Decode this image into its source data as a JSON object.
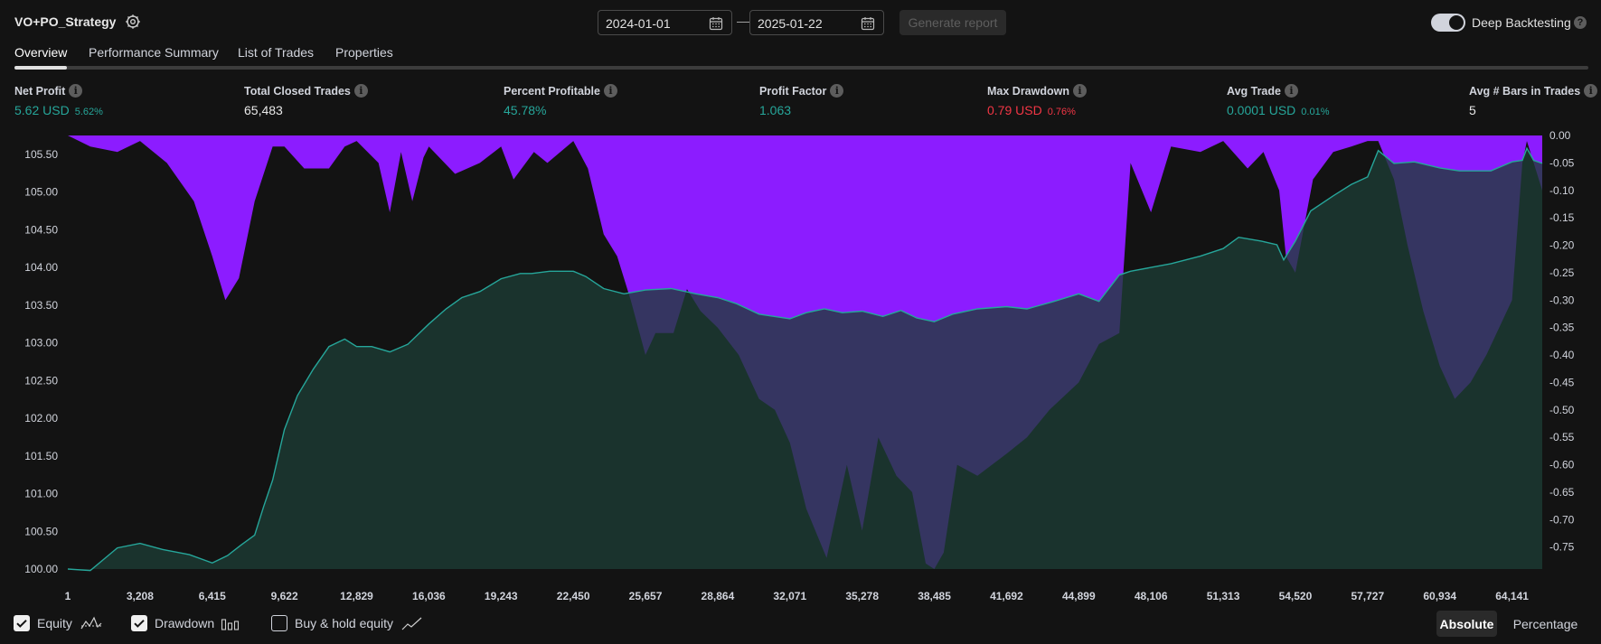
{
  "header": {
    "strategy_name": "VO+PO_Strategy",
    "start_date": "2024-01-01",
    "end_date": "2025-01-22",
    "date_separator": "—",
    "generate_label": "Generate report",
    "deep_backtesting_label": "Deep Backtesting",
    "deep_backtesting_on": true,
    "help_glyph": "?"
  },
  "tabs": [
    {
      "label": "Overview",
      "active": true
    },
    {
      "label": "Performance Summary",
      "active": false
    },
    {
      "label": "List of Trades",
      "active": false
    },
    {
      "label": "Properties",
      "active": false
    }
  ],
  "metrics": {
    "info_glyph": "i",
    "net_profit": {
      "label": "Net Profit",
      "value": "5.62 USD",
      "sub": "5.62%"
    },
    "total_closed_trades": {
      "label": "Total Closed Trades",
      "value": "65,483"
    },
    "percent_profitable": {
      "label": "Percent Profitable",
      "value": "45.78%"
    },
    "profit_factor": {
      "label": "Profit Factor",
      "value": "1.063"
    },
    "max_drawdown": {
      "label": "Max Drawdown",
      "value": "0.79 USD",
      "sub": "0.76%"
    },
    "avg_trade": {
      "label": "Avg Trade",
      "value": "0.0001 USD",
      "sub": "0.01%"
    },
    "avg_bars": {
      "label": "Avg # Bars in Trades",
      "value": "5"
    }
  },
  "legend": {
    "equity_label": "Equity",
    "equity_checked": true,
    "drawdown_label": "Drawdown",
    "drawdown_checked": true,
    "bh_label": "Buy & hold equity",
    "bh_checked": false
  },
  "modes": {
    "absolute_label": "Absolute",
    "percentage_label": "Percentage",
    "active": "Absolute"
  },
  "colors": {
    "background": "#131313",
    "equity_line": "#26a69a",
    "equity_fill": "#1c3c34",
    "drawdown_fill": "#8c1cff",
    "negative": "#f23645",
    "text": "#d1d4dc"
  },
  "chart_data": {
    "type": "area",
    "title": "",
    "xlabel": "",
    "ylabel": "",
    "x_ticks": [
      "1",
      "3,208",
      "6,415",
      "9,622",
      "12,829",
      "16,036",
      "19,243",
      "22,450",
      "25,657",
      "28,864",
      "32,071",
      "35,278",
      "38,485",
      "41,692",
      "44,899",
      "48,106",
      "51,313",
      "54,520",
      "57,727",
      "60,934",
      "64,141"
    ],
    "y_left_ticks": [
      "105.50",
      "105.00",
      "104.50",
      "104.00",
      "103.50",
      "103.00",
      "102.50",
      "102.00",
      "101.50",
      "101.00",
      "100.50",
      "100.00"
    ],
    "y_right_ticks": [
      "0.00",
      "-0.05",
      "-0.10",
      "-0.15",
      "-0.20",
      "-0.25",
      "-0.30",
      "-0.35",
      "-0.40",
      "-0.45",
      "-0.50",
      "-0.55",
      "-0.60",
      "-0.65",
      "-0.70",
      "-0.75"
    ],
    "xlim": [
      1,
      65483
    ],
    "ylim_left": [
      100.0,
      105.75
    ],
    "ylim_right": [
      -0.79,
      0.0
    ],
    "grid": false,
    "series": [
      {
        "name": "Equity",
        "x": [
          1,
          1000,
          2200,
          3208,
          4200,
          5400,
          6415,
          7100,
          7700,
          8300,
          8700,
          9100,
          9622,
          10200,
          10900,
          11600,
          12300,
          12829,
          13500,
          14300,
          15100,
          16036,
          16800,
          17500,
          18300,
          19243,
          20100,
          20600,
          21400,
          22450,
          23000,
          23800,
          24700,
          25657,
          26800,
          27900,
          28864,
          29700,
          30700,
          32071,
          32800,
          33600,
          34400,
          35278,
          36200,
          37000,
          37700,
          38485,
          39300,
          40400,
          41692,
          42600,
          43800,
          44899,
          45800,
          46700,
          47200,
          48106,
          49000,
          50300,
          51313,
          52000,
          53000,
          53700,
          54000,
          54520,
          55200,
          56200,
          57000,
          57727,
          58200,
          58900,
          59800,
          60934,
          61800,
          63200,
          64141,
          64600,
          64800,
          65100,
          65483
        ],
        "values": [
          100.0,
          99.98,
          100.28,
          100.34,
          100.26,
          100.19,
          100.08,
          100.18,
          100.32,
          100.45,
          100.83,
          101.18,
          101.85,
          102.3,
          102.65,
          102.95,
          103.05,
          102.95,
          102.95,
          102.88,
          102.98,
          103.25,
          103.45,
          103.6,
          103.68,
          103.85,
          103.92,
          103.92,
          103.95,
          103.95,
          103.88,
          103.72,
          103.65,
          103.7,
          103.72,
          103.65,
          103.6,
          103.52,
          103.38,
          103.32,
          103.4,
          103.45,
          103.4,
          103.42,
          103.35,
          103.43,
          103.33,
          103.28,
          103.38,
          103.45,
          103.48,
          103.45,
          103.55,
          103.65,
          103.55,
          103.9,
          103.95,
          104.0,
          104.05,
          104.15,
          104.25,
          104.4,
          104.35,
          104.3,
          104.1,
          104.35,
          104.75,
          104.95,
          105.1,
          105.2,
          105.55,
          105.38,
          105.4,
          105.32,
          105.28,
          105.28,
          105.4,
          105.42,
          105.58,
          105.42,
          105.38
        ]
      },
      {
        "name": "Drawdown",
        "x": [
          1,
          1000,
          2200,
          3208,
          4400,
          5600,
          6415,
          7000,
          7600,
          8300,
          9100,
          9622,
          10500,
          11600,
          12300,
          12829,
          13800,
          14300,
          14800,
          15300,
          15800,
          16036,
          17200,
          18300,
          19243,
          19800,
          20700,
          21300,
          22450,
          23100,
          23800,
          24400,
          25000,
          25657,
          26100,
          26900,
          27500,
          28100,
          28864,
          29800,
          30700,
          31400,
          32071,
          32800,
          33700,
          34600,
          35278,
          36000,
          36800,
          37500,
          38100,
          38485,
          38900,
          39500,
          40400,
          41692,
          42600,
          43600,
          44899,
          45800,
          46700,
          47200,
          48106,
          49000,
          50300,
          51313,
          52400,
          53100,
          53800,
          54100,
          54520,
          55300,
          56200,
          57000,
          57727,
          58200,
          58900,
          59500,
          60200,
          60934,
          61600,
          62300,
          63000,
          64141,
          64600,
          64800,
          65483
        ],
        "values": [
          0.0,
          -0.02,
          -0.03,
          -0.01,
          -0.05,
          -0.12,
          -0.22,
          -0.3,
          -0.26,
          -0.12,
          -0.02,
          -0.02,
          -0.06,
          -0.06,
          -0.02,
          -0.01,
          -0.05,
          -0.14,
          -0.03,
          -0.12,
          -0.04,
          -0.02,
          -0.07,
          -0.05,
          -0.02,
          -0.08,
          -0.03,
          -0.05,
          -0.01,
          -0.06,
          -0.18,
          -0.22,
          -0.3,
          -0.4,
          -0.36,
          -0.36,
          -0.28,
          -0.32,
          -0.35,
          -0.4,
          -0.48,
          -0.5,
          -0.56,
          -0.68,
          -0.77,
          -0.6,
          -0.72,
          -0.55,
          -0.62,
          -0.65,
          -0.78,
          -0.79,
          -0.76,
          -0.6,
          -0.62,
          -0.58,
          -0.55,
          -0.5,
          -0.45,
          -0.38,
          -0.36,
          -0.05,
          -0.14,
          -0.02,
          -0.03,
          -0.01,
          -0.06,
          -0.03,
          -0.1,
          -0.22,
          -0.25,
          -0.08,
          -0.03,
          -0.02,
          -0.01,
          -0.01,
          -0.08,
          -0.2,
          -0.32,
          -0.42,
          -0.48,
          -0.45,
          -0.4,
          -0.3,
          -0.05,
          -0.01,
          -0.1
        ]
      }
    ]
  }
}
